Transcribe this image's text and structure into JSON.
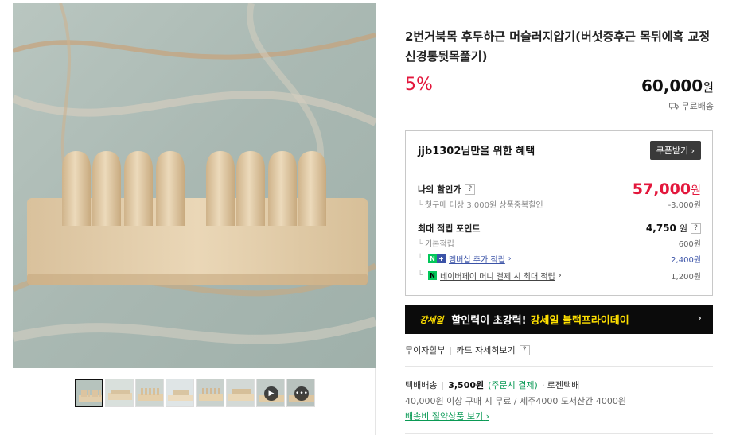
{
  "gallery": {
    "thumbnails": [
      {
        "kind": "image"
      },
      {
        "kind": "image"
      },
      {
        "kind": "image"
      },
      {
        "kind": "image"
      },
      {
        "kind": "image"
      },
      {
        "kind": "image"
      },
      {
        "kind": "video",
        "icon": "play-icon"
      },
      {
        "kind": "review",
        "icon": "chat-icon"
      }
    ]
  },
  "product": {
    "title": "2번거북목 후두하근 머슬러지압기(버섯증후근 목뒤에혹 교정 신경통뒷목풀기)",
    "discount_rate": "5%",
    "price": "60,000",
    "price_unit": "원",
    "shipping_badge": "무료배송"
  },
  "benefit": {
    "title": "jjb1302님만을 위한 혜택",
    "coupon_button": "쿠폰받기",
    "my_price_label": "나의 할인가",
    "my_price": "57,000",
    "my_price_unit": "원",
    "first_purchase_label": "첫구매 대상 3,000원 상품중복할인",
    "first_purchase_value": "-3,000원",
    "points_label": "최대 적립 포인트",
    "points_value": "4,750",
    "points_unit": "원",
    "base_points_label": "기본적립",
    "base_points_value": "600원",
    "membership_label": "멤버십 추가 적립",
    "membership_value": "2,400원",
    "npay_label": "네이버페이 머니 결제 시 최대 적립",
    "npay_value": "1,200원",
    "help_mark": "?"
  },
  "banner": {
    "logo": "강세일",
    "text1": "할인력이 초강력!",
    "text2": "강세일 블랙프라이데이",
    "chevron": "›"
  },
  "payment": {
    "installment": "무이자할부",
    "card_detail": "카드 자세히보기"
  },
  "shipping": {
    "label": "택배배송",
    "fee": "3,500원",
    "fee_note": "(주문시 결제)",
    "carrier": "· 로젠택배",
    "condition": "40,000원 이상 구매 시 무료 / 제주4000 도서산간 4000원",
    "saving_link": "배송비 절약상품 보기"
  },
  "colors": {
    "accent_red": "#e3173c",
    "membership_blue": "#3b53a7",
    "naver_green": "#03c75a",
    "banner_yellow": "#ffe000"
  }
}
